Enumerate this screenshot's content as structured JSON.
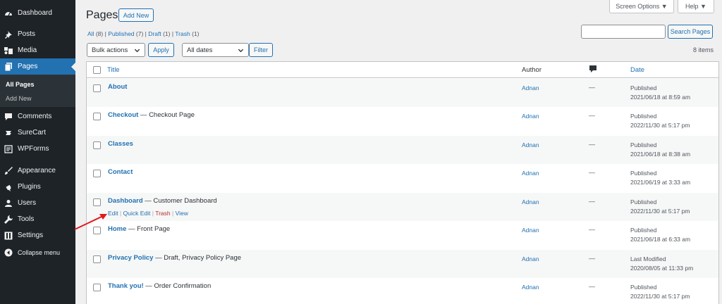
{
  "sidebar": {
    "items": [
      {
        "label": "Dashboard",
        "icon": "dashboard-icon"
      },
      {
        "label": "Posts",
        "icon": "pin-icon"
      },
      {
        "label": "Media",
        "icon": "media-icon"
      },
      {
        "label": "Pages",
        "icon": "pages-icon"
      },
      {
        "label": "Comments",
        "icon": "comment-icon"
      },
      {
        "label": "SureCart",
        "icon": "surecart-icon"
      },
      {
        "label": "WPForms",
        "icon": "wpforms-icon"
      },
      {
        "label": "Appearance",
        "icon": "brush-icon"
      },
      {
        "label": "Plugins",
        "icon": "plug-icon"
      },
      {
        "label": "Users",
        "icon": "user-icon"
      },
      {
        "label": "Tools",
        "icon": "wrench-icon"
      },
      {
        "label": "Settings",
        "icon": "settings-icon"
      },
      {
        "label": "Collapse menu",
        "icon": "collapse-icon"
      }
    ],
    "submenu": [
      "All Pages",
      "Add New"
    ]
  },
  "header": {
    "screen_options": "Screen Options ▼",
    "help": "Help ▼",
    "title": "Pages",
    "add_new": "Add New"
  },
  "filters": {
    "all": "All",
    "all_count": "(8)",
    "published": "Published",
    "published_count": "(7)",
    "draft": "Draft",
    "draft_count": "(1)",
    "trash": "Trash",
    "trash_count": "(1)",
    "sep": "|"
  },
  "search": {
    "value": "",
    "button": "Search Pages"
  },
  "toolbar": {
    "bulk_actions": "Bulk actions",
    "apply": "Apply",
    "dates": "All dates",
    "filter": "Filter",
    "items": "8 items"
  },
  "table": {
    "headers": {
      "title": "Title",
      "author": "Author",
      "date": "Date"
    },
    "rows": [
      {
        "title": "About",
        "suffix": "",
        "author": "Adnan",
        "comments": "—",
        "status": "Published",
        "date": "2021/06/18 at 8:59 am"
      },
      {
        "title": "Checkout",
        "suffix": " — Checkout Page",
        "author": "Adnan",
        "comments": "—",
        "status": "Published",
        "date": "2022/11/30 at 5:17 pm"
      },
      {
        "title": "Classes",
        "suffix": "",
        "author": "Adnan",
        "comments": "—",
        "status": "Published",
        "date": "2021/06/18 at 8:38 am"
      },
      {
        "title": "Contact",
        "suffix": "",
        "author": "Adnan",
        "comments": "—",
        "status": "Published",
        "date": "2021/06/19 at 3:33 am"
      },
      {
        "title": "Dashboard",
        "suffix": " — Customer Dashboard",
        "author": "Adnan",
        "comments": "—",
        "status": "Published",
        "date": "2022/11/30 at 5:17 pm"
      },
      {
        "title": "Home",
        "suffix": " — Front Page",
        "author": "Adnan",
        "comments": "—",
        "status": "Published",
        "date": "2021/06/18 at 6:33 am"
      },
      {
        "title": "Privacy Policy",
        "suffix": " — Draft, Privacy Policy Page",
        "author": "Adnan",
        "comments": "—",
        "status": "Last Modified",
        "date": "2020/08/05 at 11:33 pm"
      },
      {
        "title": "Thank you!",
        "suffix": " — Order Confirmation",
        "author": "Adnan",
        "comments": "—",
        "status": "Published",
        "date": "2022/11/30 at 5:17 pm"
      }
    ],
    "row_actions": {
      "edit": "Edit",
      "quick_edit": "Quick Edit",
      "trash": "Trash",
      "view": "View",
      "sep": "|"
    }
  },
  "colors": {
    "sidebar": "#1d2327",
    "accent": "#2271b1",
    "arrow": "#e0191c"
  }
}
